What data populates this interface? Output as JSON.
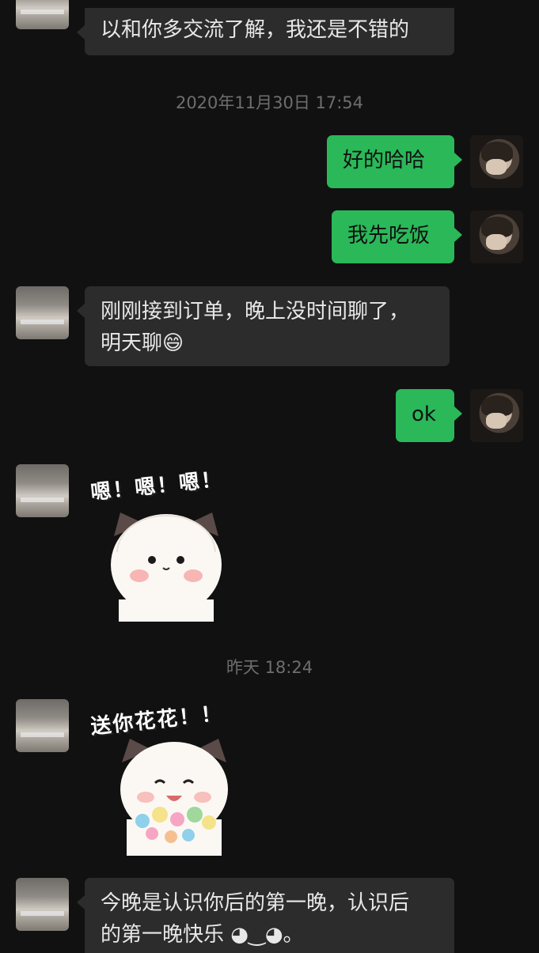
{
  "messages": {
    "m1": "以和你多交流了解，我还是不错的",
    "t1": "2020年11月30日 17:54",
    "m2": "好的哈哈",
    "m3": "我先吃饭",
    "m4_line1": "刚刚接到订单，晚上没时间聊了，",
    "m4_line2": "明天聊",
    "m4_emoji": "😄",
    "m5": "ok",
    "sticker1_caption": "嗯！嗯！嗯！",
    "t2": "昨天 18:24",
    "sticker2_caption": "送你花花！！",
    "m6_line1": "今晚是认识你后的第一晚，认识后",
    "m6_line2": "的第一晚快乐 ◕‿◕。"
  },
  "colors": {
    "background": "#111111",
    "incoming_bubble": "#2c2c2c",
    "outgoing_bubble": "#2ab859",
    "timestamp": "#6e6e6e"
  }
}
